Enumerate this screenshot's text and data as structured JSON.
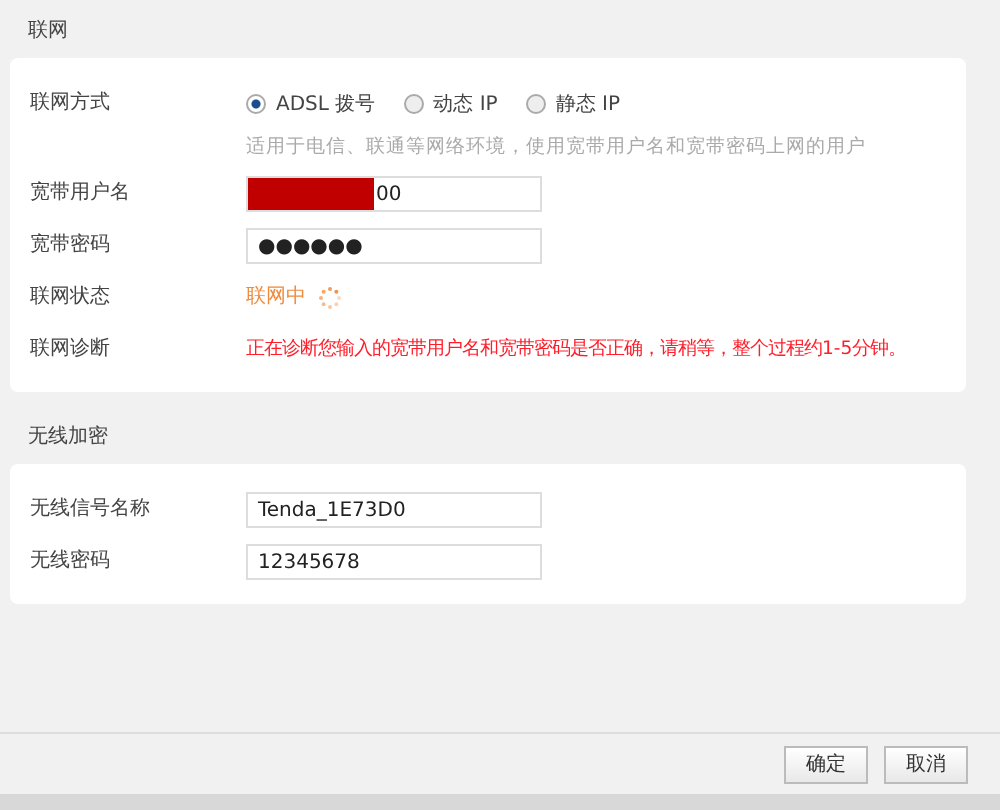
{
  "sections": [
    {
      "title": "联网",
      "rows": [
        {
          "kind": "radio",
          "label": "联网方式",
          "options": [
            {
              "label": "ADSL 拨号",
              "selected": true
            },
            {
              "label": "动态 IP",
              "selected": false
            },
            {
              "label": "静态 IP",
              "selected": false
            }
          ],
          "hint": "适用于电信、联通等网络环境，使用宽带用户名和宽带密码上网的用户"
        },
        {
          "kind": "input",
          "label": "宽带用户名",
          "value": "00",
          "redacted": true
        },
        {
          "kind": "input",
          "label": "宽带密码",
          "value": "●●●●●●"
        },
        {
          "kind": "status",
          "label": "联网状态",
          "value": "联网中"
        },
        {
          "kind": "alert",
          "label": "联网诊断",
          "value": "正在诊断您输入的宽带用户名和宽带密码是否正确，请稍等，整个过程约1-5分钟。"
        }
      ]
    },
    {
      "title": "无线加密",
      "rows": [
        {
          "kind": "input",
          "label": "无线信号名称",
          "value": "Tenda_1E73D0"
        },
        {
          "kind": "input",
          "label": "无线密码",
          "value": "12345678"
        }
      ]
    }
  ],
  "buttons": [
    "确定",
    "取消"
  ]
}
